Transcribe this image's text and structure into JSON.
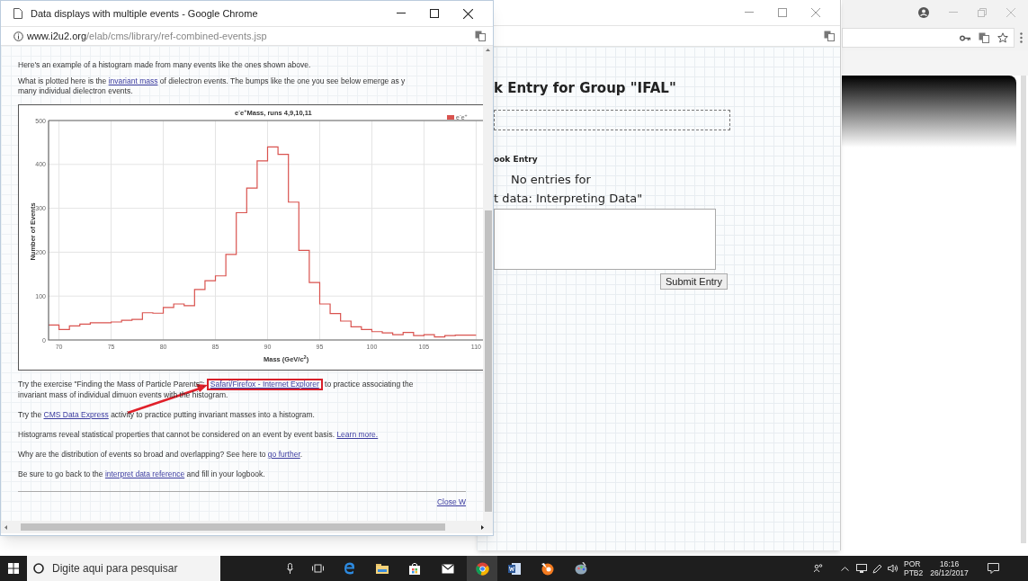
{
  "popup_window": {
    "title": "Data displays with multiple events - Google Chrome",
    "url_host": "www.i2u2.org",
    "url_path": "/elab/cms/library/ref-combined-events.jsp",
    "paragraphs_top": [
      {
        "parts": [
          {
            "kind": "text",
            "text": "Here's an example of a histogram made from many events like the ones shown above."
          }
        ]
      },
      {
        "parts": [
          {
            "kind": "text",
            "text": "What is plotted here is the "
          },
          {
            "kind": "link",
            "text": "invariant mass",
            "highlighted": false
          },
          {
            "kind": "text",
            "text": " of dielectron events. The bumps like the one you see below emerge as y"
          },
          {
            "kind": "break"
          },
          {
            "kind": "text",
            "text": "many individual dielectron events."
          }
        ]
      }
    ],
    "chart_data": {
      "type": "line",
      "title": "e$^{-}$e$^{+}$Mass, runs 4,9,10,11",
      "xlabel": "Mass (GeV/c$^{2}$)",
      "ylabel": "Number of Events",
      "x": [
        69,
        70,
        70,
        71,
        71,
        72,
        72,
        73,
        73,
        74,
        74,
        75,
        75,
        76,
        76,
        77,
        77,
        78,
        78,
        79,
        79,
        80,
        80,
        81,
        81,
        82,
        82,
        83,
        83,
        84,
        84,
        85,
        85,
        86,
        86,
        87,
        87,
        88,
        88,
        89,
        89,
        90,
        90,
        91,
        91,
        92,
        92,
        93,
        93,
        94,
        94,
        95,
        95,
        96,
        96,
        97,
        97,
        98,
        98,
        99,
        99,
        100,
        100,
        101,
        101,
        102,
        102,
        103,
        103,
        104,
        104,
        105,
        105,
        106,
        106,
        107,
        107,
        108,
        108,
        109,
        109,
        110
      ],
      "series": [
        {
          "name": "e$^{-}$e$^{+}$",
          "color": "#d9534f",
          "values": [
            34,
            34,
            24,
            24,
            32,
            32,
            36,
            36,
            39,
            39,
            39,
            39,
            41,
            41,
            45,
            45,
            47,
            47,
            62,
            62,
            61,
            61,
            74,
            74,
            82,
            82,
            78,
            78,
            115,
            115,
            135,
            135,
            146,
            146,
            195,
            195,
            290,
            290,
            346,
            346,
            408,
            408,
            440,
            440,
            423,
            423,
            314,
            314,
            204,
            204,
            131,
            131,
            82,
            82,
            60,
            60,
            43,
            43,
            30,
            30,
            24,
            24,
            19,
            19,
            16,
            16,
            12,
            12,
            17,
            17,
            10,
            10,
            12,
            12,
            7,
            7,
            10,
            10,
            11,
            11,
            11,
            11
          ]
        }
      ],
      "xlim": [
        69,
        111
      ],
      "ylim": [
        0,
        500
      ],
      "xticks": [
        70,
        75,
        80,
        85,
        90,
        95,
        100,
        105,
        110
      ],
      "grid": true,
      "yticks": [
        0,
        100,
        200,
        300,
        400,
        500
      ]
    },
    "paragraphs_bottom": [
      {
        "parts": [
          {
            "kind": "text",
            "text": "Try the exercise \"Finding the Mass of Particle Parents\": "
          },
          {
            "kind": "link",
            "text": "Safari/Firefox - Internet Explorer",
            "highlighted": true
          },
          {
            "kind": "text",
            "text": " to practice associating the"
          },
          {
            "kind": "break"
          },
          {
            "kind": "text",
            "text": "invariant mass of individual dimuon events with the histogram."
          }
        ]
      },
      {
        "parts": [
          {
            "kind": "text",
            "text": "Try the "
          },
          {
            "kind": "link",
            "text": "CMS Data Express",
            "highlighted": false
          },
          {
            "kind": "text",
            "text": " activity to practice putting invariant masses into a histogram."
          }
        ]
      },
      {
        "parts": [
          {
            "kind": "text",
            "text": "Histograms reveal statistical properties that cannot be considered on an event by event basis. "
          },
          {
            "kind": "link",
            "text": "Learn more.",
            "highlighted": false
          }
        ]
      },
      {
        "parts": [
          {
            "kind": "text",
            "text": "Why are the distribution of events so broad and overlapping? See here to "
          },
          {
            "kind": "link",
            "text": "go further",
            "highlighted": false
          },
          {
            "kind": "text",
            "text": "."
          }
        ]
      },
      {
        "parts": [
          {
            "kind": "text",
            "text": "Be sure to go back to the "
          },
          {
            "kind": "link",
            "text": "interpret data reference",
            "highlighted": false
          },
          {
            "kind": "text",
            "text": " and fill in your logbook."
          }
        ]
      }
    ],
    "close_link": "Close W"
  },
  "logbook_window": {
    "heading": "k Entry for Group \"IFAL\"",
    "entry_label": "ook Entry",
    "no_entries_lines": [
      "No entries for",
      "t data: Interpreting Data\""
    ],
    "submit_button": "Submit Entry"
  },
  "taskbar": {
    "search_placeholder": "Digite aqui para pesquisar",
    "language": "POR",
    "keyboard": "PTB2",
    "time": "16:16",
    "date": "26/12/2017"
  }
}
